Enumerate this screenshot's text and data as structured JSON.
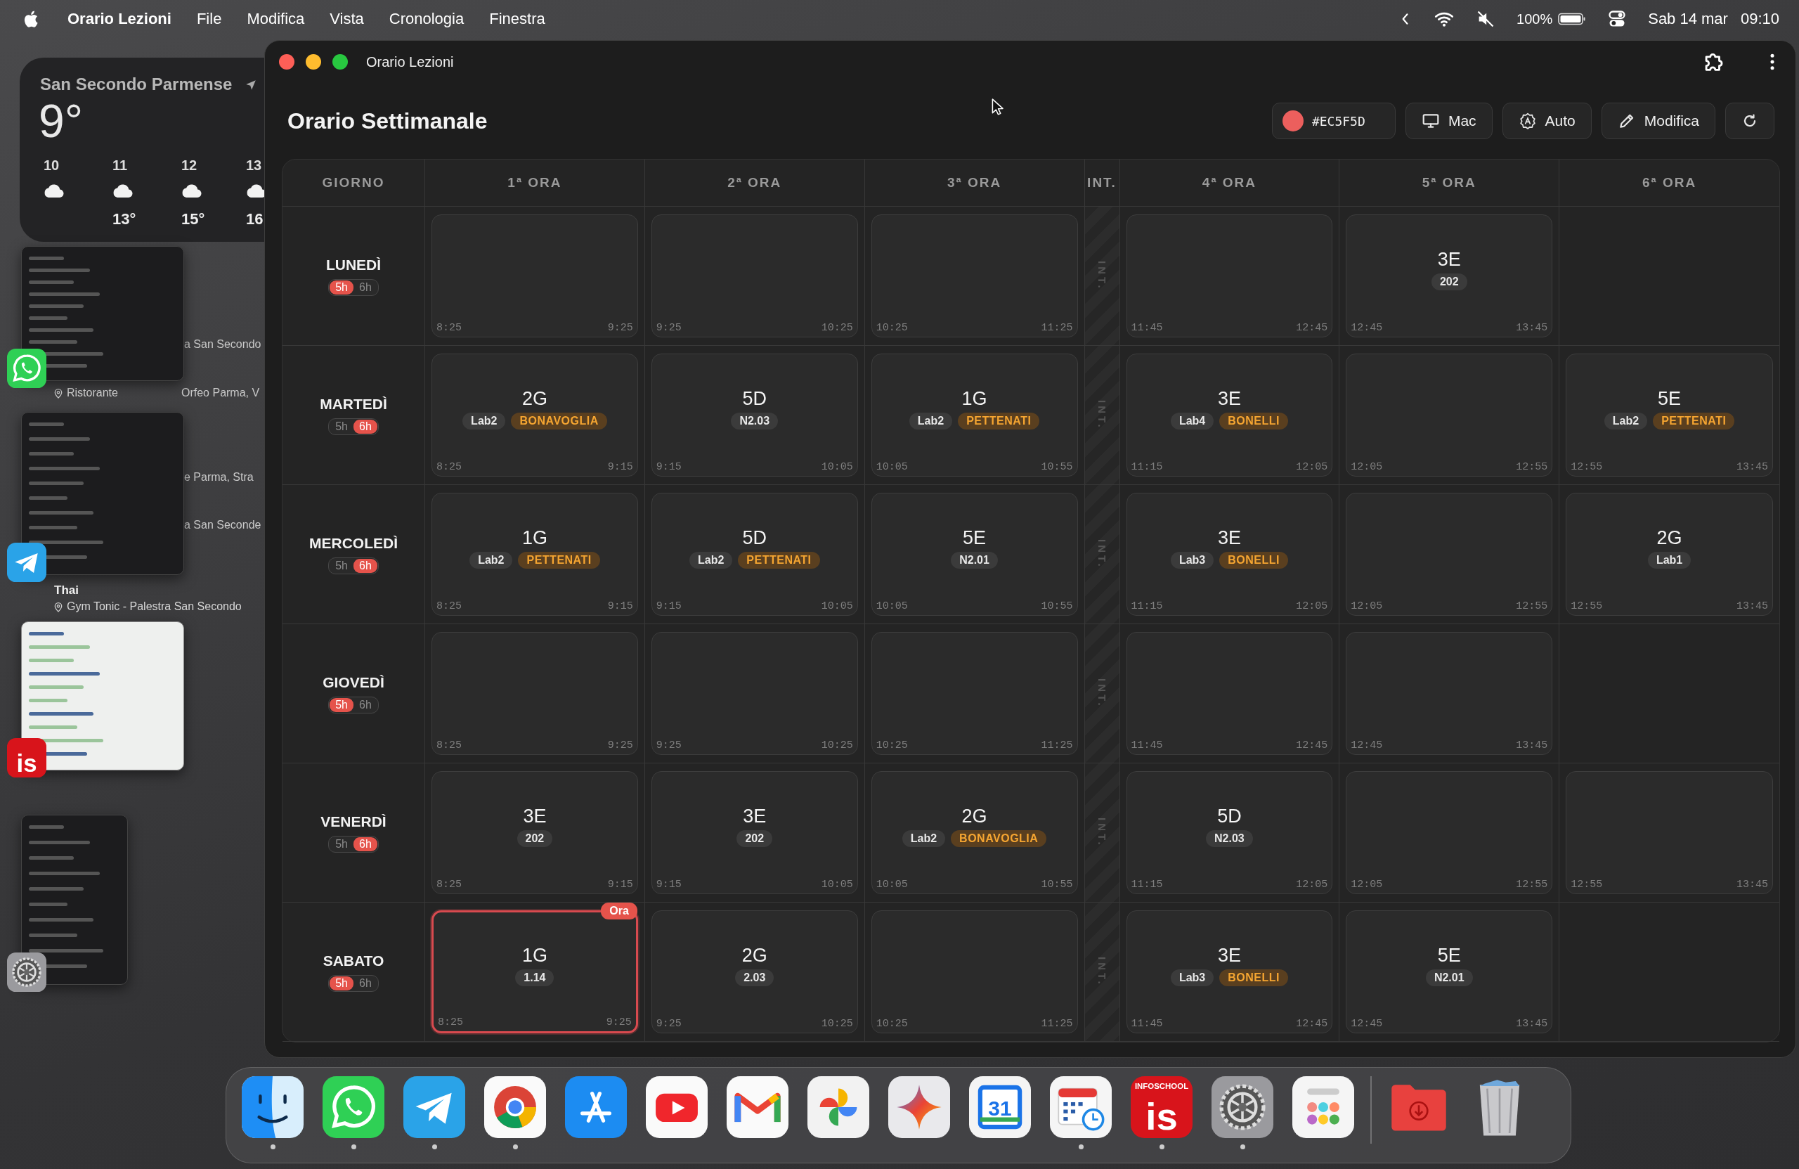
{
  "menu_bar": {
    "app_name": "Orario Lezioni",
    "menus": [
      "File",
      "Modifica",
      "Vista",
      "Cronologia",
      "Finestra"
    ],
    "battery_text": "100%",
    "date": "Sab 14 mar",
    "time": "09:10"
  },
  "desktop": {
    "weather": {
      "location": "San Secondo Parmense",
      "temperature": "9°",
      "forecast": [
        {
          "hour": "10"
        },
        {
          "hour": "11",
          "temp": "13°"
        },
        {
          "hour": "12",
          "temp": "15°"
        },
        {
          "hour": "13",
          "temp": "16"
        }
      ]
    },
    "calendar_lines": [
      {
        "kind": "plain",
        "text": "a San Secondo"
      },
      {
        "kind": "location",
        "text": "Ristorante"
      },
      {
        "kind": "plain",
        "text": "Orfeo Parma, V"
      },
      {
        "kind": "plain",
        "text": "e Parma, Stra"
      },
      {
        "kind": "plain",
        "text": "a San Seconde"
      },
      {
        "kind": "title",
        "text": "Thai"
      },
      {
        "kind": "location",
        "text": "Gym Tonic - Palestra San Secondo"
      }
    ],
    "stage_manager": [
      {
        "kind": "whatsapp",
        "light": false
      },
      {
        "kind": "telegram",
        "light": false
      },
      {
        "kind": "infoschool",
        "light": true,
        "label": "is"
      },
      {
        "kind": "settings",
        "light": false
      }
    ]
  },
  "window": {
    "title": "Orario Lezioni",
    "heading": "Orario Settimanale",
    "color_field": {
      "value": "#EC5F5D",
      "color": "#ec5f5d"
    },
    "buttons": [
      {
        "kind": "monitor",
        "label": "Mac"
      },
      {
        "kind": "auto",
        "label": "Auto"
      },
      {
        "kind": "edit",
        "label": "Modifica"
      },
      {
        "kind": "refresh"
      }
    ]
  },
  "timetable": {
    "columns": [
      "GIORNO",
      "1ª ORA",
      "2ª ORA",
      "3ª ORA",
      "INT.",
      "4ª ORA",
      "5ª ORA",
      "6ª ORA"
    ],
    "days": [
      {
        "name": "LUNEDÌ",
        "hours": [
          {
            "label": "5h",
            "selected": true
          },
          {
            "label": "6h",
            "selected": false
          }
        ],
        "break_label": "INT.",
        "slots": [
          {
            "kind": "empty",
            "start": "8:25",
            "end": "9:25"
          },
          {
            "kind": "empty",
            "start": "9:25",
            "end": "10:25"
          },
          {
            "kind": "empty",
            "start": "10:25",
            "end": "11:25"
          },
          {
            "kind": "empty",
            "start": "11:45",
            "end": "12:45"
          },
          {
            "kind": "lesson",
            "class": "3E",
            "room": "202",
            "start": "12:45",
            "end": "13:45",
            "current": false
          },
          {
            "kind": "none"
          }
        ]
      },
      {
        "name": "MARTEDÌ",
        "hours": [
          {
            "label": "5h",
            "selected": false
          },
          {
            "label": "6h",
            "selected": true
          }
        ],
        "break_label": "INT.",
        "slots": [
          {
            "kind": "lesson",
            "class": "2G",
            "room": "Lab2",
            "teacher": "BONAVOGLIA",
            "start": "8:25",
            "end": "9:15",
            "current": false
          },
          {
            "kind": "lesson",
            "class": "5D",
            "room": "N2.03",
            "start": "9:15",
            "end": "10:05",
            "current": false
          },
          {
            "kind": "lesson",
            "class": "1G",
            "room": "Lab2",
            "teacher": "PETTENATI",
            "start": "10:05",
            "end": "10:55",
            "current": false
          },
          {
            "kind": "lesson",
            "class": "3E",
            "room": "Lab4",
            "teacher": "BONELLI",
            "start": "11:15",
            "end": "12:05",
            "current": false
          },
          {
            "kind": "empty",
            "start": "12:05",
            "end": "12:55"
          },
          {
            "kind": "lesson",
            "class": "5E",
            "room": "Lab2",
            "teacher": "PETTENATI",
            "start": "12:55",
            "end": "13:45",
            "current": false
          }
        ]
      },
      {
        "name": "MERCOLEDÌ",
        "hours": [
          {
            "label": "5h",
            "selected": false
          },
          {
            "label": "6h",
            "selected": true
          }
        ],
        "break_label": "INT.",
        "slots": [
          {
            "kind": "lesson",
            "class": "1G",
            "room": "Lab2",
            "teacher": "PETTENATI",
            "start": "8:25",
            "end": "9:15",
            "current": false
          },
          {
            "kind": "lesson",
            "class": "5D",
            "room": "Lab2",
            "teacher": "PETTENATI",
            "start": "9:15",
            "end": "10:05",
            "current": false
          },
          {
            "kind": "lesson",
            "class": "5E",
            "room": "N2.01",
            "start": "10:05",
            "end": "10:55",
            "current": false
          },
          {
            "kind": "lesson",
            "class": "3E",
            "room": "Lab3",
            "teacher": "BONELLI",
            "start": "11:15",
            "end": "12:05",
            "current": false
          },
          {
            "kind": "empty",
            "start": "12:05",
            "end": "12:55"
          },
          {
            "kind": "lesson",
            "class": "2G",
            "room": "Lab1",
            "start": "12:55",
            "end": "13:45",
            "current": false
          }
        ]
      },
      {
        "name": "GIOVEDÌ",
        "hours": [
          {
            "label": "5h",
            "selected": true
          },
          {
            "label": "6h",
            "selected": false
          }
        ],
        "break_label": "INT.",
        "slots": [
          {
            "kind": "empty",
            "start": "8:25",
            "end": "9:25"
          },
          {
            "kind": "empty",
            "start": "9:25",
            "end": "10:25"
          },
          {
            "kind": "empty",
            "start": "10:25",
            "end": "11:25"
          },
          {
            "kind": "empty",
            "start": "11:45",
            "end": "12:45"
          },
          {
            "kind": "empty",
            "start": "12:45",
            "end": "13:45"
          },
          {
            "kind": "none"
          }
        ]
      },
      {
        "name": "VENERDÌ",
        "hours": [
          {
            "label": "5h",
            "selected": false
          },
          {
            "label": "6h",
            "selected": true
          }
        ],
        "break_label": "INT.",
        "slots": [
          {
            "kind": "lesson",
            "class": "3E",
            "room": "202",
            "start": "8:25",
            "end": "9:15",
            "current": false
          },
          {
            "kind": "lesson",
            "class": "3E",
            "room": "202",
            "start": "9:15",
            "end": "10:05",
            "current": false
          },
          {
            "kind": "lesson",
            "class": "2G",
            "room": "Lab2",
            "teacher": "BONAVOGLIA",
            "start": "10:05",
            "end": "10:55",
            "current": false
          },
          {
            "kind": "lesson",
            "class": "5D",
            "room": "N2.03",
            "start": "11:15",
            "end": "12:05",
            "current": false
          },
          {
            "kind": "empty",
            "start": "12:05",
            "end": "12:55"
          },
          {
            "kind": "empty",
            "start": "12:55",
            "end": "13:45"
          }
        ]
      },
      {
        "name": "SABATO",
        "hours": [
          {
            "label": "5h",
            "selected": true
          },
          {
            "label": "6h",
            "selected": false
          }
        ],
        "break_label": "INT.",
        "slots": [
          {
            "kind": "lesson",
            "class": "1G",
            "room": "1.14",
            "start": "8:25",
            "end": "9:25",
            "current": true,
            "badge": "Ora"
          },
          {
            "kind": "lesson",
            "class": "2G",
            "room": "2.03",
            "start": "9:25",
            "end": "10:25",
            "current": false
          },
          {
            "kind": "empty",
            "start": "10:25",
            "end": "11:25"
          },
          {
            "kind": "lesson",
            "class": "3E",
            "room": "Lab3",
            "teacher": "BONELLI",
            "start": "11:45",
            "end": "12:45",
            "current": false
          },
          {
            "kind": "lesson",
            "class": "5E",
            "room": "N2.01",
            "start": "12:45",
            "end": "13:45",
            "current": false
          },
          {
            "kind": "none"
          }
        ]
      }
    ]
  },
  "dock": {
    "apps": [
      {
        "kind": "finder",
        "running": true
      },
      {
        "kind": "whatsapp",
        "running": true
      },
      {
        "kind": "telegram",
        "running": true
      },
      {
        "kind": "chrome",
        "running": true
      },
      {
        "kind": "appstore",
        "running": false
      },
      {
        "kind": "youtube",
        "running": false
      },
      {
        "kind": "gmail",
        "running": false
      },
      {
        "kind": "photos",
        "running": false
      },
      {
        "kind": "gemini",
        "running": false
      },
      {
        "kind": "calendar",
        "label": "31",
        "running": false
      },
      {
        "kind": "planner",
        "running": true
      },
      {
        "kind": "infoschool",
        "caption": "INFOSCHOOL",
        "label": "is",
        "running": true
      },
      {
        "kind": "settings",
        "running": true
      },
      {
        "kind": "launcher",
        "running": false
      },
      {
        "kind": "separator"
      },
      {
        "kind": "folder",
        "running": false
      },
      {
        "kind": "trash",
        "running": false
      }
    ]
  }
}
